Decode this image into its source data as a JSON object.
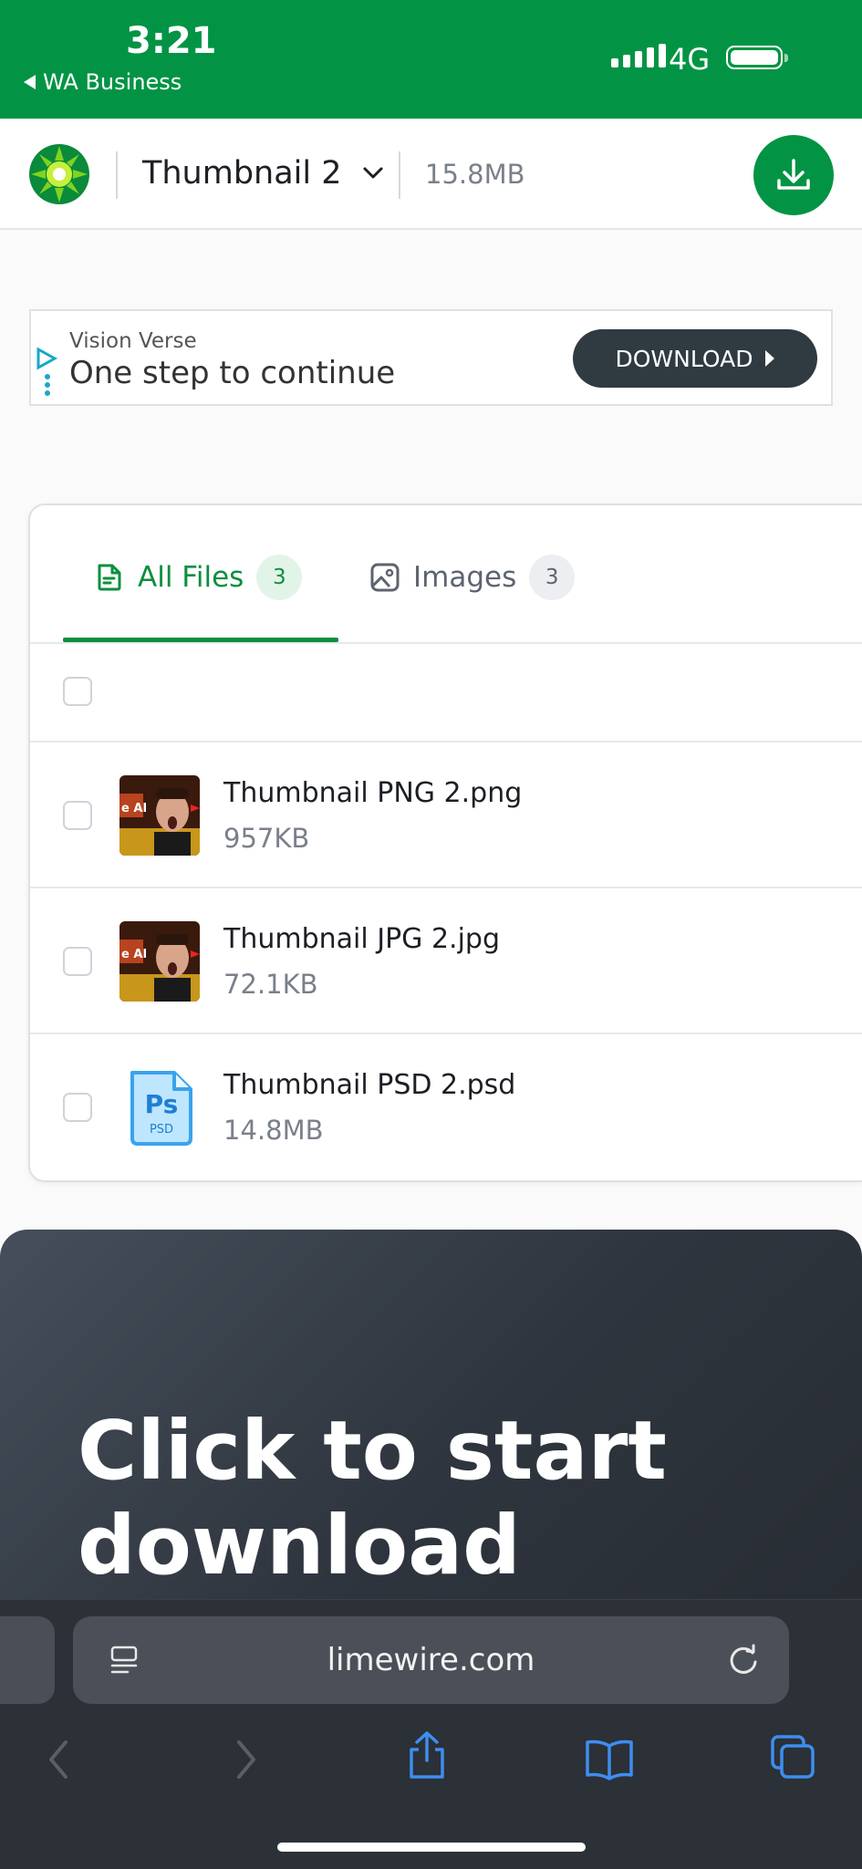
{
  "status_bar": {
    "time": "3:21",
    "back_app": "WA Business",
    "network": "4G"
  },
  "header": {
    "file_title": "Thumbnail 2",
    "total_size": "15.8MB",
    "accent_color": "#029444"
  },
  "ad": {
    "brand": "Vision Verse",
    "headline": "One step to continue",
    "button_label": "DOWNLOAD"
  },
  "file_list": {
    "tabs": [
      {
        "label": "All Files",
        "count": "3",
        "active": true
      },
      {
        "label": "Images",
        "count": "3",
        "active": false
      }
    ],
    "files": [
      {
        "name": "Thumbnail PNG 2.png",
        "size": "957KB",
        "icon": "image-thumbnail"
      },
      {
        "name": "Thumbnail JPG 2.jpg",
        "size": "72.1KB",
        "icon": "image-thumbnail"
      },
      {
        "name": "Thumbnail PSD 2.psd",
        "size": "14.8MB",
        "icon": "photoshop-file-icon"
      }
    ]
  },
  "promo": {
    "title_line1": "Click to start",
    "title_line2": "download"
  },
  "browser": {
    "url": "limewire.com"
  }
}
